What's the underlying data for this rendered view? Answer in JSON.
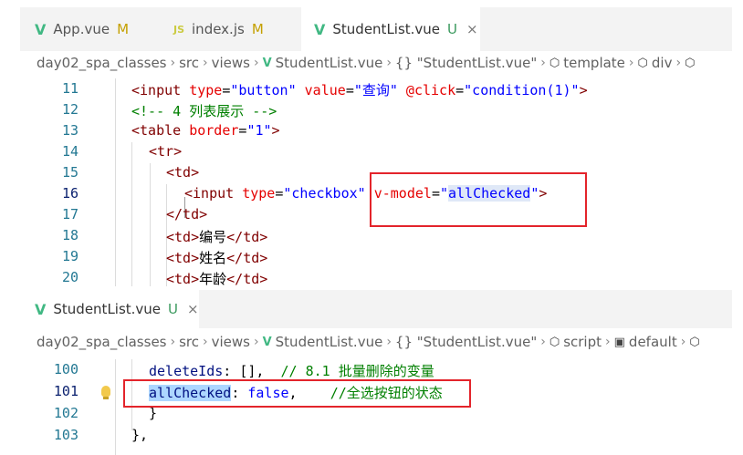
{
  "top_tabs": [
    {
      "icon": "vue-icon",
      "icon_text": "V",
      "label": "App.vue",
      "status": "M"
    },
    {
      "icon": "js-icon",
      "icon_text": "JS",
      "label": "index.js",
      "status": "M"
    },
    {
      "icon": "vue-icon",
      "icon_text": "V",
      "label": "StudentList.vue",
      "status": "U",
      "close": "×"
    }
  ],
  "breadcrumb1": [
    "day02_spa_classes",
    "src",
    "views",
    "StudentList.vue",
    "{} \"StudentList.vue\"",
    "template",
    "div"
  ],
  "code1": {
    "lines": [
      "11",
      "12",
      "13",
      "14",
      "15",
      "16",
      "17",
      "18",
      "19",
      "20"
    ],
    "l11": {
      "tag_open": "<input ",
      "a1": "type",
      "eq": "=",
      "v1": "\"button\"",
      "a2": " value",
      "v2": "\"查询\"",
      "a3": " @click",
      "v3": "\"condition(1)\"",
      "close": ">"
    },
    "l12": {
      "comment": "<!-- 4 列表展示 -->"
    },
    "l13": {
      "tag_open": "<table ",
      "a1": "border",
      "eq": "=",
      "v1": "\"1\"",
      "close": ">"
    },
    "l14": {
      "tag": "<tr>"
    },
    "l15": {
      "tag": "<td>"
    },
    "l16": {
      "tag_open": "<input ",
      "a1": "type",
      "eq": "=",
      "v1": "\"checkbox\"",
      "a2": " v-model",
      "v2_q1": "\"",
      "v2_val": "allChecked",
      "v2_q2": "\"",
      "close": ">"
    },
    "l17": {
      "tag": "</td>"
    },
    "l18": {
      "o": "<td>",
      "t": "编号",
      "c": "</td>"
    },
    "l19": {
      "o": "<td>",
      "t": "姓名",
      "c": "</td>"
    },
    "l20": {
      "o": "<td>",
      "t": "年龄",
      "c": "</td>"
    }
  },
  "bottom_tab": {
    "icon_text": "V",
    "label": "StudentList.vue",
    "status": "U",
    "close": "×"
  },
  "breadcrumb2": [
    "day02_spa_classes",
    "src",
    "views",
    "StudentList.vue",
    "{} \"StudentList.vue\"",
    "script",
    "default"
  ],
  "code2": {
    "lines": [
      "100",
      "101",
      "102",
      "103"
    ],
    "l100": {
      "prop": "deleteIds",
      "rest": ": [],  ",
      "comment": "// 8.1 批量删除的变量"
    },
    "l101": {
      "prop": "allChecked",
      "colon": ": ",
      "kw": "false",
      "comma": ",    ",
      "comment": "//全选按钮的状态"
    },
    "l102": {
      "text": "}"
    },
    "l103": {
      "text": "},"
    }
  },
  "colors": {
    "vue_green": "#41b883",
    "highlight_red": "#e3242b",
    "tag": "#800000",
    "attr": "#e50000",
    "string": "#0000ff",
    "comment": "#008000"
  }
}
